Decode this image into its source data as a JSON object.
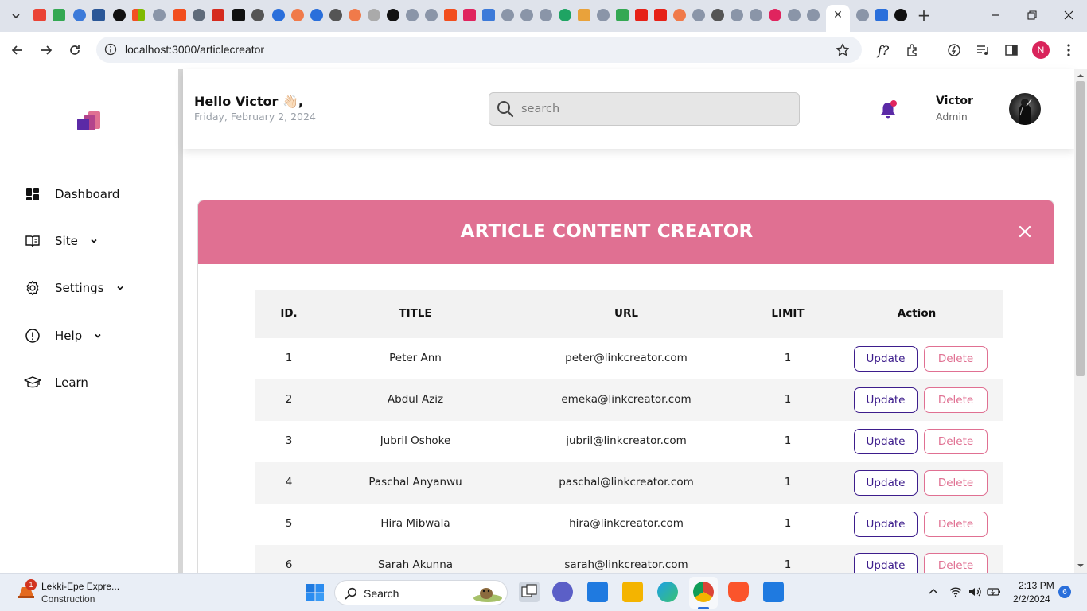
{
  "browser": {
    "url": "localhost:3000/articlecreator",
    "profile_initial": "N"
  },
  "sidebar": {
    "items": [
      {
        "label": "Dashboard",
        "icon": "dashboard-icon"
      },
      {
        "label": "Site",
        "icon": "site-icon"
      },
      {
        "label": "Settings",
        "icon": "gear-icon"
      },
      {
        "label": "Help",
        "icon": "help-icon"
      },
      {
        "label": "Learn",
        "icon": "graduation-cap-icon"
      }
    ]
  },
  "header": {
    "greeting": "Hello Victor 👋🏻,",
    "date": "Friday, February 2, 2024",
    "search_placeholder": "search",
    "user_name": "Victor",
    "user_role": "Admin"
  },
  "card": {
    "title": "ARTICLE CONTENT CREATOR",
    "accent": "#e07092"
  },
  "table": {
    "columns": [
      "ID.",
      "TITLE",
      "URL",
      "LIMIT",
      "Action"
    ],
    "rows": [
      {
        "id": "1",
        "title": "Peter Ann",
        "url": "peter@linkcreator.com",
        "limit": "1"
      },
      {
        "id": "2",
        "title": "Abdul Aziz",
        "url": "emeka@linkcreator.com",
        "limit": "1"
      },
      {
        "id": "3",
        "title": "Jubril Oshoke",
        "url": "jubril@linkcreator.com",
        "limit": "1"
      },
      {
        "id": "4",
        "title": "Paschal Anyanwu",
        "url": "paschal@linkcreator.com",
        "limit": "1"
      },
      {
        "id": "5",
        "title": "Hira Mibwala",
        "url": "hira@linkcreator.com",
        "limit": "1"
      },
      {
        "id": "6",
        "title": "Sarah Akunna",
        "url": "sarah@linkcreator.com",
        "limit": "1"
      }
    ],
    "update_label": "Update",
    "delete_label": "Delete"
  },
  "taskbar": {
    "weather_title": "Lekki-Epe Expre...",
    "weather_sub": "Construction",
    "weather_badge": "1",
    "search_label": "Search",
    "time": "2:13 PM",
    "date": "2/2/2024",
    "notifications": "6"
  }
}
